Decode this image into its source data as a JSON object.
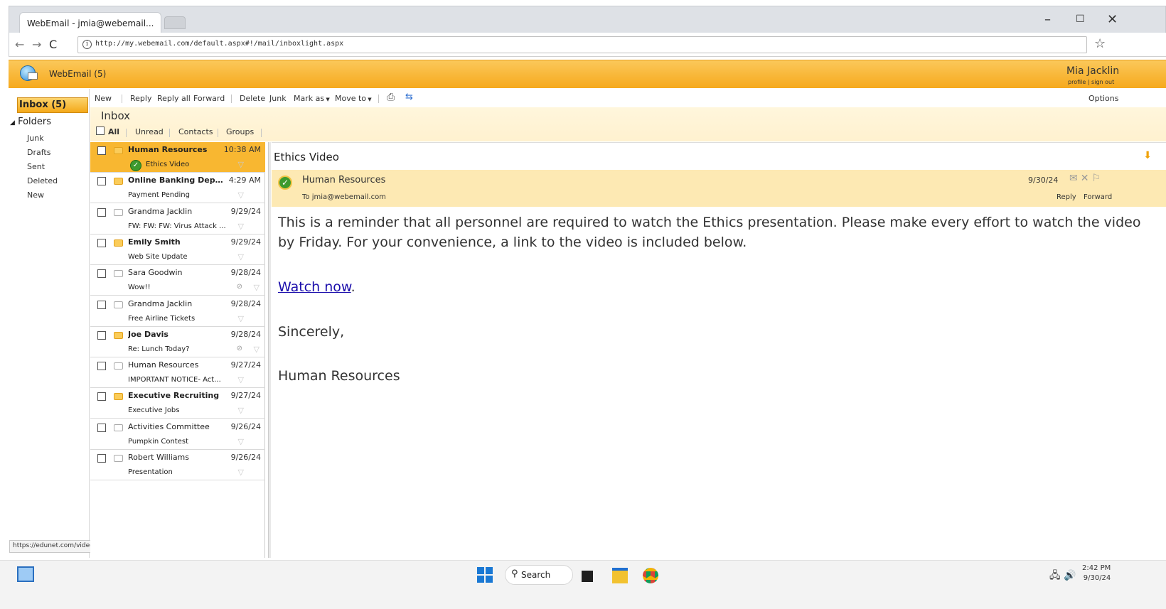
{
  "browser": {
    "tab_title": "WebEmail - jmia@webemail...",
    "url": "http://my.webemail.com/default.aspx#!/mail/inboxlight.aspx",
    "status_url": "https://edunet.com/videos/ethics.wmv"
  },
  "app": {
    "name": "WebEmail (5)",
    "user_name": "Mia Jacklin",
    "user_links": "profile | sign out",
    "options": "Options"
  },
  "sidebar": {
    "inbox_label": "Inbox (5)",
    "folders_label": "Folders",
    "folders": [
      "Junk",
      "Drafts",
      "Sent",
      "Deleted",
      "New"
    ]
  },
  "toolbar": {
    "new": "New",
    "reply": "Reply",
    "reply_all": "Reply all",
    "forward": "Forward",
    "delete": "Delete",
    "junk": "Junk",
    "mark_as": "Mark as",
    "move_to": "Move to"
  },
  "inbox": {
    "title": "Inbox",
    "filters": {
      "all": "All",
      "unread": "Unread",
      "contacts": "Contacts",
      "groups": "Groups"
    }
  },
  "messages": [
    {
      "sender": "Human Resources",
      "date": "10:38 AM",
      "subject": "Ethics Video",
      "unread": true,
      "selected": true
    },
    {
      "sender": "Online Banking Depart...",
      "date": "4:29 AM",
      "subject": "Payment Pending",
      "unread": true
    },
    {
      "sender": "Grandma Jacklin",
      "date": "9/29/24",
      "subject": "FW: FW: FW: Virus Attack ...",
      "unread": false
    },
    {
      "sender": "Emily Smith",
      "date": "9/29/24",
      "subject": "Web Site Update",
      "unread": true
    },
    {
      "sender": "Sara Goodwin",
      "date": "9/28/24",
      "subject": "Wow!!",
      "unread": false,
      "attachment": true
    },
    {
      "sender": "Grandma Jacklin",
      "date": "9/28/24",
      "subject": "Free Airline Tickets",
      "unread": false
    },
    {
      "sender": "Joe Davis",
      "date": "9/28/24",
      "subject": "Re: Lunch Today?",
      "unread": true,
      "attachment": true
    },
    {
      "sender": "Human Resources",
      "date": "9/27/24",
      "subject": "IMPORTANT NOTICE- Act...",
      "unread": false
    },
    {
      "sender": "Executive Recruiting",
      "date": "9/27/24",
      "subject": "Executive Jobs",
      "unread": true
    },
    {
      "sender": "Activities Committee",
      "date": "9/26/24",
      "subject": "Pumpkin Contest",
      "unread": false
    },
    {
      "sender": "Robert Williams",
      "date": "9/26/24",
      "subject": "Presentation",
      "unread": false
    }
  ],
  "reading": {
    "subject": "Ethics Video",
    "from": "Human Resources",
    "to": "To jmia@webemail.com",
    "date": "9/30/24",
    "reply": "Reply",
    "forward": "Forward",
    "body_p1": "This is a reminder that all personnel are required to watch the Ethics presentation. Please make every effort to watch the video by Friday. For your convenience, a link to the video is included below.",
    "link_text": "Watch now",
    "link_suffix": ".",
    "closing": "Sincerely,",
    "signature": "Human Resources"
  },
  "taskbar": {
    "search": "Search",
    "time": "2:42 PM",
    "date": "9/30/24"
  },
  "colors": {
    "header_orange": "#f6a91d",
    "selected_row": "#f8b731",
    "reading_header": "#fde9b3",
    "link": "#1a0dab"
  }
}
